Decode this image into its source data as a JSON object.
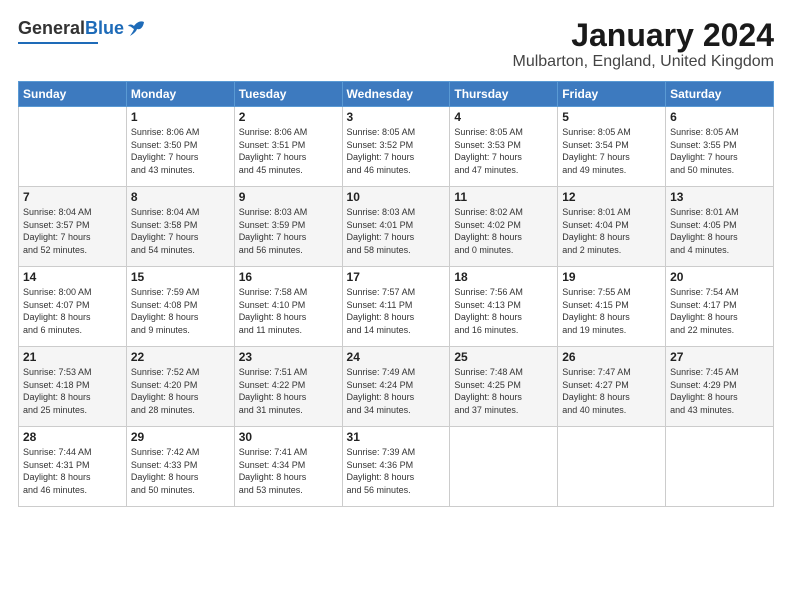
{
  "logo": {
    "general": "General",
    "blue": "Blue"
  },
  "header": {
    "title": "January 2024",
    "subtitle": "Mulbarton, England, United Kingdom"
  },
  "weekdays": [
    "Sunday",
    "Monday",
    "Tuesday",
    "Wednesday",
    "Thursday",
    "Friday",
    "Saturday"
  ],
  "weeks": [
    [
      {
        "day": "",
        "info": ""
      },
      {
        "day": "1",
        "info": "Sunrise: 8:06 AM\nSunset: 3:50 PM\nDaylight: 7 hours\nand 43 minutes."
      },
      {
        "day": "2",
        "info": "Sunrise: 8:06 AM\nSunset: 3:51 PM\nDaylight: 7 hours\nand 45 minutes."
      },
      {
        "day": "3",
        "info": "Sunrise: 8:05 AM\nSunset: 3:52 PM\nDaylight: 7 hours\nand 46 minutes."
      },
      {
        "day": "4",
        "info": "Sunrise: 8:05 AM\nSunset: 3:53 PM\nDaylight: 7 hours\nand 47 minutes."
      },
      {
        "day": "5",
        "info": "Sunrise: 8:05 AM\nSunset: 3:54 PM\nDaylight: 7 hours\nand 49 minutes."
      },
      {
        "day": "6",
        "info": "Sunrise: 8:05 AM\nSunset: 3:55 PM\nDaylight: 7 hours\nand 50 minutes."
      }
    ],
    [
      {
        "day": "7",
        "info": "Sunrise: 8:04 AM\nSunset: 3:57 PM\nDaylight: 7 hours\nand 52 minutes."
      },
      {
        "day": "8",
        "info": "Sunrise: 8:04 AM\nSunset: 3:58 PM\nDaylight: 7 hours\nand 54 minutes."
      },
      {
        "day": "9",
        "info": "Sunrise: 8:03 AM\nSunset: 3:59 PM\nDaylight: 7 hours\nand 56 minutes."
      },
      {
        "day": "10",
        "info": "Sunrise: 8:03 AM\nSunset: 4:01 PM\nDaylight: 7 hours\nand 58 minutes."
      },
      {
        "day": "11",
        "info": "Sunrise: 8:02 AM\nSunset: 4:02 PM\nDaylight: 8 hours\nand 0 minutes."
      },
      {
        "day": "12",
        "info": "Sunrise: 8:01 AM\nSunset: 4:04 PM\nDaylight: 8 hours\nand 2 minutes."
      },
      {
        "day": "13",
        "info": "Sunrise: 8:01 AM\nSunset: 4:05 PM\nDaylight: 8 hours\nand 4 minutes."
      }
    ],
    [
      {
        "day": "14",
        "info": "Sunrise: 8:00 AM\nSunset: 4:07 PM\nDaylight: 8 hours\nand 6 minutes."
      },
      {
        "day": "15",
        "info": "Sunrise: 7:59 AM\nSunset: 4:08 PM\nDaylight: 8 hours\nand 9 minutes."
      },
      {
        "day": "16",
        "info": "Sunrise: 7:58 AM\nSunset: 4:10 PM\nDaylight: 8 hours\nand 11 minutes."
      },
      {
        "day": "17",
        "info": "Sunrise: 7:57 AM\nSunset: 4:11 PM\nDaylight: 8 hours\nand 14 minutes."
      },
      {
        "day": "18",
        "info": "Sunrise: 7:56 AM\nSunset: 4:13 PM\nDaylight: 8 hours\nand 16 minutes."
      },
      {
        "day": "19",
        "info": "Sunrise: 7:55 AM\nSunset: 4:15 PM\nDaylight: 8 hours\nand 19 minutes."
      },
      {
        "day": "20",
        "info": "Sunrise: 7:54 AM\nSunset: 4:17 PM\nDaylight: 8 hours\nand 22 minutes."
      }
    ],
    [
      {
        "day": "21",
        "info": "Sunrise: 7:53 AM\nSunset: 4:18 PM\nDaylight: 8 hours\nand 25 minutes."
      },
      {
        "day": "22",
        "info": "Sunrise: 7:52 AM\nSunset: 4:20 PM\nDaylight: 8 hours\nand 28 minutes."
      },
      {
        "day": "23",
        "info": "Sunrise: 7:51 AM\nSunset: 4:22 PM\nDaylight: 8 hours\nand 31 minutes."
      },
      {
        "day": "24",
        "info": "Sunrise: 7:49 AM\nSunset: 4:24 PM\nDaylight: 8 hours\nand 34 minutes."
      },
      {
        "day": "25",
        "info": "Sunrise: 7:48 AM\nSunset: 4:25 PM\nDaylight: 8 hours\nand 37 minutes."
      },
      {
        "day": "26",
        "info": "Sunrise: 7:47 AM\nSunset: 4:27 PM\nDaylight: 8 hours\nand 40 minutes."
      },
      {
        "day": "27",
        "info": "Sunrise: 7:45 AM\nSunset: 4:29 PM\nDaylight: 8 hours\nand 43 minutes."
      }
    ],
    [
      {
        "day": "28",
        "info": "Sunrise: 7:44 AM\nSunset: 4:31 PM\nDaylight: 8 hours\nand 46 minutes."
      },
      {
        "day": "29",
        "info": "Sunrise: 7:42 AM\nSunset: 4:33 PM\nDaylight: 8 hours\nand 50 minutes."
      },
      {
        "day": "30",
        "info": "Sunrise: 7:41 AM\nSunset: 4:34 PM\nDaylight: 8 hours\nand 53 minutes."
      },
      {
        "day": "31",
        "info": "Sunrise: 7:39 AM\nSunset: 4:36 PM\nDaylight: 8 hours\nand 56 minutes."
      },
      {
        "day": "",
        "info": ""
      },
      {
        "day": "",
        "info": ""
      },
      {
        "day": "",
        "info": ""
      }
    ]
  ]
}
